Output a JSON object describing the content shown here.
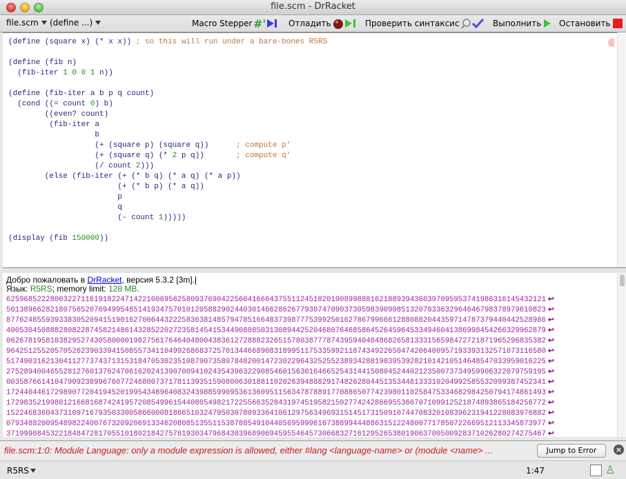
{
  "window": {
    "title": "file.scm - DrRacket"
  },
  "toolbar": {
    "file_menu": "file.scm",
    "define_menu": "(define ...)",
    "macro_stepper": "Macro Stepper",
    "debug": "Отладить",
    "check_syntax": "Проверить синтаксис",
    "run": "Выполнить",
    "stop": "Остановить",
    "colors": {
      "run": "#3cc13c",
      "stop": "#e02020",
      "stepper": "#3a3adf"
    }
  },
  "editor": {
    "lines": [
      [
        {
          "t": "(define (square x) (* x x)) "
        },
        {
          "t": "; so this will run under a bare-bones R5RS",
          "c": "cm"
        }
      ],
      [
        {
          "t": ""
        }
      ],
      [
        {
          "t": "(define (fib n)"
        }
      ],
      [
        {
          "t": "  (fib-iter "
        },
        {
          "t": "1 0 0 1",
          "c": "num"
        },
        {
          "t": " n))"
        }
      ],
      [
        {
          "t": ""
        }
      ],
      [
        {
          "t": "(define (fib-iter a b p q count)"
        }
      ],
      [
        {
          "t": "  (cond ((= count "
        },
        {
          "t": "0",
          "c": "num"
        },
        {
          "t": ") b)"
        }
      ],
      [
        {
          "t": "        ((even? count)"
        }
      ],
      [
        {
          "t": "         (fib-iter a"
        }
      ],
      [
        {
          "t": "                   b"
        }
      ],
      [
        {
          "t": "                   (+ (square p) (square q))      "
        },
        {
          "t": "; compute p'",
          "c": "cm"
        }
      ],
      [
        {
          "t": "                   (+ (square q) (* "
        },
        {
          "t": "2",
          "c": "num"
        },
        {
          "t": " p q))       "
        },
        {
          "t": "; compute q'",
          "c": "cm"
        }
      ],
      [
        {
          "t": "                   (/ count "
        },
        {
          "t": "2",
          "c": "num"
        },
        {
          "t": ")))"
        }
      ],
      [
        {
          "t": "        (else (fib-iter (+ (* b q) (* a q) (* a p))"
        }
      ],
      [
        {
          "t": "                        (+ (* b p) (* a q))"
        }
      ],
      [
        {
          "t": "                        p"
        }
      ],
      [
        {
          "t": "                        q"
        }
      ],
      [
        {
          "t": "                        (- count "
        },
        {
          "t": "1",
          "c": "num"
        },
        {
          "t": ")))))"
        }
      ],
      [
        {
          "t": ""
        }
      ],
      [
        {
          "t": "(display (fib "
        },
        {
          "t": "150000",
          "c": "num"
        },
        {
          "t": "))"
        }
      ]
    ]
  },
  "interactions": {
    "welcome_prefix": "Добро пожаловать в ",
    "welcome_link": "DrRacket",
    "welcome_suffix": ", версия 5.3.2 [3m].",
    "language_label": "Язык: ",
    "language_value": "R5RS",
    "memory_text": "; memory limit: ",
    "memory_value": "128 MB",
    "memory_end": ".",
    "output_lines": [
      "6259685222800322711619182247142210069562580937690422560416664375511245182019089988816218893943603970959537419863161454321217",
      "5013896628218075652076949954851419347570101205882902440301466286267793074709037305983909085132070336329646467983789796108230",
      "8776248559393383052094151901627006443222583638148579478516648373987775399250162786799666128808820443597147873794404425289862",
      "4005304508882808228745821486143285220272358145415344908085031308944252046807646858645264596453349460413869984542663299628799",
      "0626781958103829527430580000198275617646404800438361272888232651578038777874395940404868265813331565984727218719652968353826",
      "9642512552057052623903394150855734110499268683725701344668908318995117533599211874349226504742064009571933931325710731165805",
      "5174903162130411277374371315318470530235108790735807848200147230229643252552389342881903953928210142105146485470339590162259",
      "2752894004655281276013762470616202413907009410243543963229085460156301646652543144150804524402123500737349599063220797591958",
      "0035876614104790923899676077246800737178113935159080063018811020263948882917482628044513534481333102049925855320993874523415",
      "1724404461729890772041945201995434896408324398859909536136095115634787889177088650774239801102584753346829842507941748614933",
      "1729835219980121668168742419572085499615440805498217225566352843197451958215027742428669553667071099125218748938651842567724",
      "1522468360437310971679350330058660008186651032479503078093364106129756349693151451731509107447083201083962319412280839768828",
      "0793488200954898224007673209206913346208085135511538788549104405695999616738899444886315122480077178507226695121133458739772",
      "3719990845322184847281705510180218427576193034796843039689069459554645730668327161295265380190637005009283710262802742754672"
    ],
    "wrap_glyph": "↩"
  },
  "error_bar": {
    "message": "file.scm:1:0: Module Language: only a module expression is allowed, either #lang <language-name> or (module <name> ...",
    "jump_button": "Jump to Error",
    "close_glyph": "×"
  },
  "statusbar": {
    "language": "R5RS",
    "position": "1:47",
    "gc_glyph": "♙"
  }
}
